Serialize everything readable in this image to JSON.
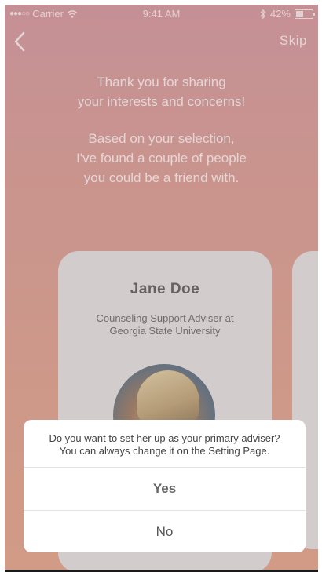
{
  "status_bar": {
    "carrier": "Carrier",
    "time": "9:41 AM",
    "battery": "42%",
    "battery_level": 0.42
  },
  "nav": {
    "skip_label": "Skip"
  },
  "intro": {
    "line1": "Thank you for sharing",
    "line2": "your interests and concerns!",
    "line3": "Based on your selection,",
    "line4": "I've found a couple of people",
    "line5": "you could be a friend with."
  },
  "card": {
    "name": "Jane Doe",
    "role_line1": "Counseling Support Adviser at",
    "role_line2": "Georgia State University"
  },
  "dialog": {
    "message_line1": "Do you want to set her up as your primary adviser?",
    "message_line2": "You can always change it on the Setting Page.",
    "yes_label": "Yes",
    "no_label": "No"
  },
  "colors": {
    "gradient_top": "#d9a0a6",
    "gradient_bottom": "#e6ac93",
    "card_bg": "#e9e4e5"
  }
}
